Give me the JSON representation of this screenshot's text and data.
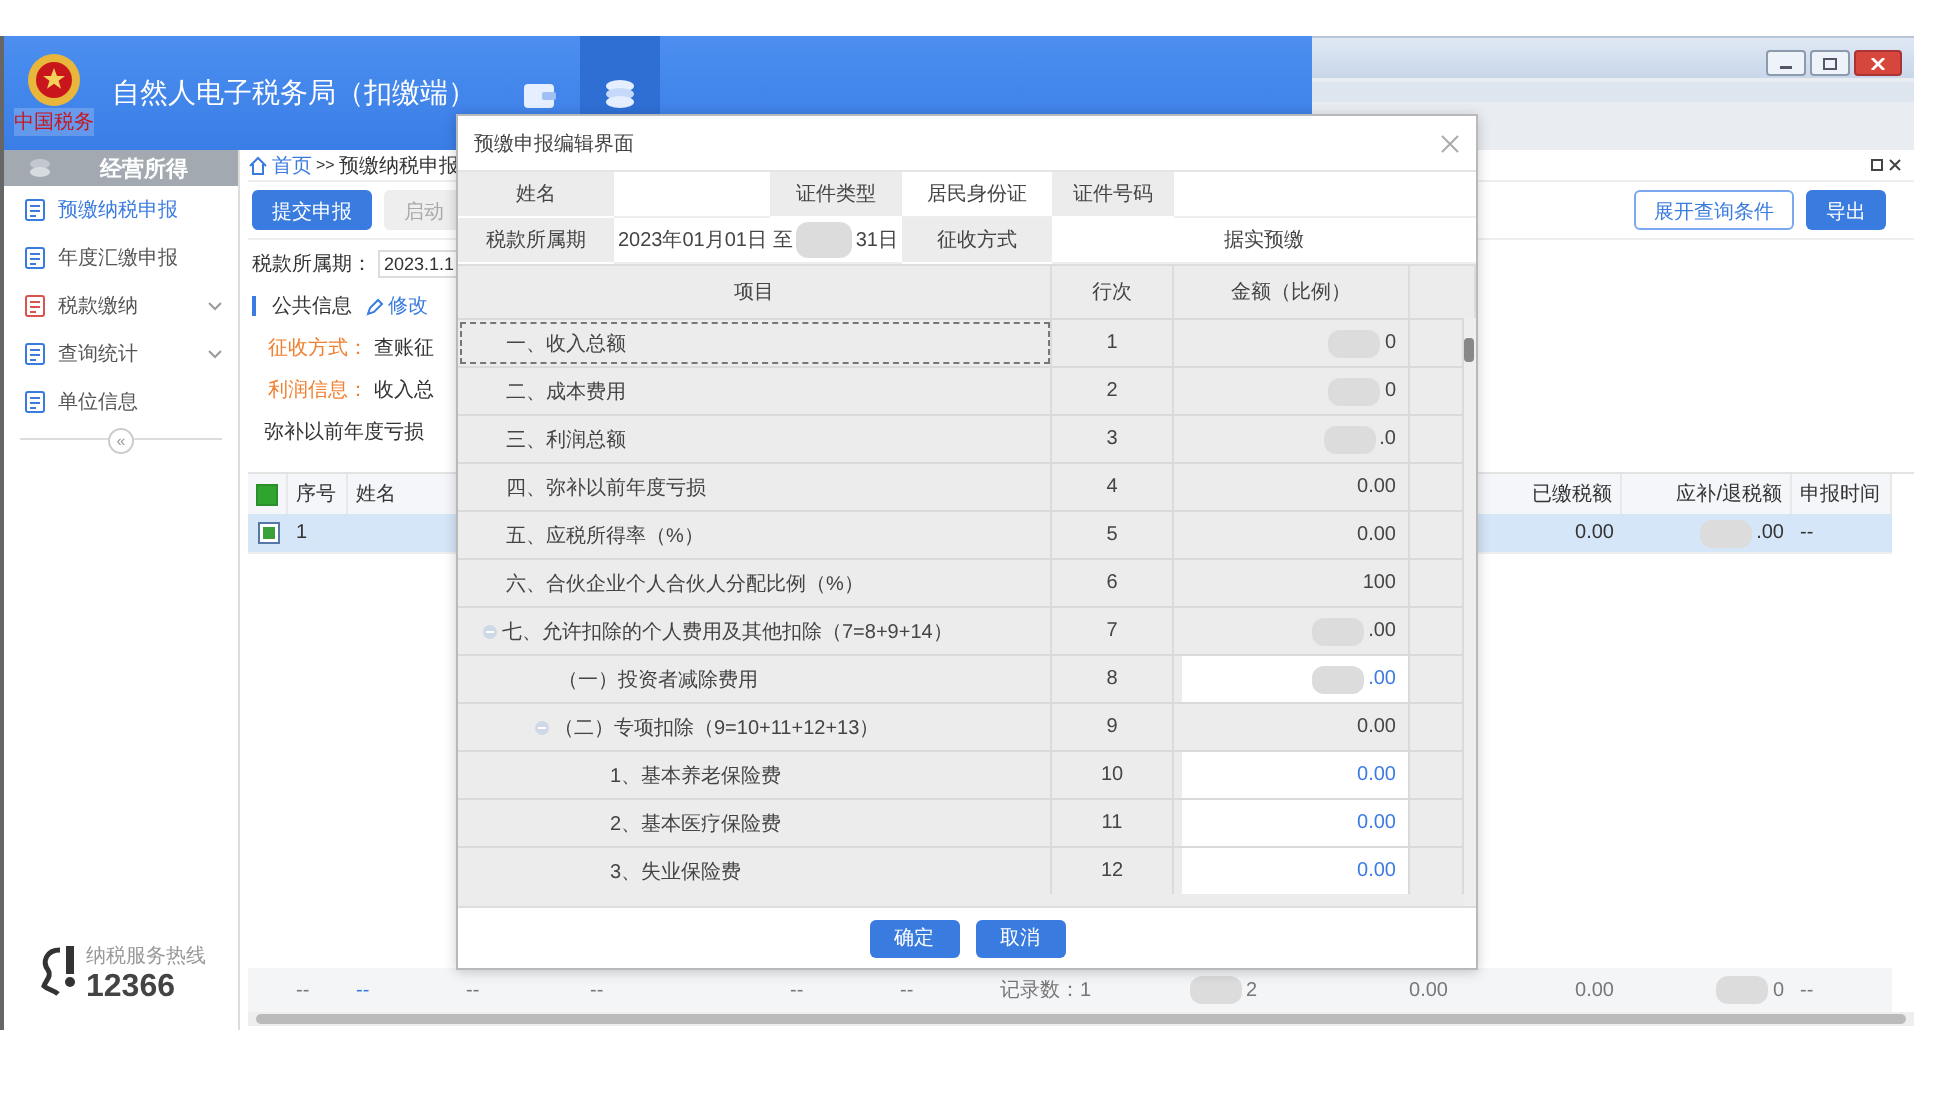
{
  "header": {
    "emblem_text": "中国税务",
    "title": "自然人电子税务局（扣缴端）",
    "nav": [
      {
        "selected": false
      },
      {
        "selected": true
      }
    ]
  },
  "sidebar": {
    "heading": "经营所得",
    "items": [
      {
        "label": "预缴纳税申报",
        "selected": true,
        "expandable": false
      },
      {
        "label": "年度汇缴申报",
        "selected": false,
        "expandable": false
      },
      {
        "label": "税款缴纳",
        "selected": false,
        "expandable": true
      },
      {
        "label": "查询统计",
        "selected": false,
        "expandable": true
      },
      {
        "label": "单位信息",
        "selected": false,
        "expandable": false
      }
    ],
    "collapse": "«",
    "hotline_label": "纳税服务热线",
    "hotline": "12366"
  },
  "breadcrumb": {
    "home": "首页",
    "separator": ">>",
    "current": "预缴纳税申报"
  },
  "toolbar": {
    "buttons": [
      {
        "label": "提交申报",
        "kind": "primary"
      },
      {
        "label": "启动",
        "kind": "default"
      }
    ],
    "right_buttons": [
      {
        "label": "展开查询条件",
        "kind": "outline"
      },
      {
        "label": "导出",
        "kind": "primary"
      }
    ]
  },
  "period": {
    "label": "税款所属期：",
    "value": "2023.1.1"
  },
  "public_info": {
    "title": "公共信息",
    "edit": "修改",
    "lines": [
      {
        "label": "征收方式：",
        "value": "查账征"
      },
      {
        "label": "利润信息：",
        "value": "收入总"
      }
    ],
    "loss_label": "弥补以前年度亏损"
  },
  "table": {
    "all_checked": true,
    "columns": [
      "序号",
      "姓名",
      "已缴税额",
      "应补/退税额",
      "申报时间"
    ],
    "rows": [
      {
        "checked": true,
        "selected": true,
        "no": "1",
        "paid": "0.00",
        "due": ".00",
        "due_redacted": true,
        "time": "--"
      }
    ],
    "footer": [
      {
        "text": "--",
        "kind": "plain",
        "redacted": false
      },
      {
        "text": "--",
        "kind": "link",
        "redacted": false
      },
      {
        "text": "--",
        "kind": "plain",
        "redacted": false
      },
      {
        "text": "--",
        "kind": "plain",
        "redacted": false
      },
      {
        "text": "--",
        "kind": "plain",
        "redacted": false
      },
      {
        "text": "--",
        "kind": "plain",
        "redacted": false
      },
      {
        "text": "记录数：1",
        "kind": "plain",
        "redacted": false
      },
      {
        "text": "2",
        "kind": "plain",
        "redacted": true
      },
      {
        "text": "0.00",
        "kind": "plain",
        "redacted": false
      },
      {
        "text": "0.00",
        "kind": "plain",
        "redacted": false
      },
      {
        "text": "0",
        "kind": "plain",
        "redacted": true
      },
      {
        "text": "--",
        "kind": "plain",
        "redacted": false
      }
    ]
  },
  "modal": {
    "title": "预缴申报编辑界面",
    "info": {
      "name_label": "姓名",
      "id_type_label": "证件类型",
      "id_type": "居民身份证",
      "id_no_label": "证件号码",
      "period_label": "税款所属期",
      "period_start": "2023年01月01日 至",
      "period_end": "31日",
      "collection_label": "征收方式",
      "collection": "据实预缴"
    },
    "columns": [
      "项目",
      "行次",
      "金额（比例）"
    ],
    "rows": [
      {
        "item": "一、收入总额",
        "line": "1",
        "amount": "0",
        "editable": false,
        "redacted": true,
        "selected": true
      },
      {
        "item": "二、成本费用",
        "line": "2",
        "amount": "0",
        "editable": false,
        "redacted": true,
        "selected": false
      },
      {
        "item": "三、利润总额",
        "line": "3",
        "amount": ".0",
        "editable": false,
        "redacted": true,
        "selected": false
      },
      {
        "item": "四、弥补以前年度亏损",
        "line": "4",
        "amount": "0.00",
        "editable": false,
        "redacted": false,
        "selected": false
      },
      {
        "item": "五、应税所得率（%）",
        "line": "5",
        "amount": "0.00",
        "editable": false,
        "redacted": false,
        "selected": false
      },
      {
        "item": "六、合伙企业个人合伙人分配比例（%）",
        "line": "6",
        "amount": "100",
        "editable": false,
        "redacted": false,
        "selected": false
      },
      {
        "item": "七、允许扣除的个人费用及其他扣除（7=8+9+14）",
        "line": "7",
        "amount": ".00",
        "editable": false,
        "redacted": true,
        "selected": false,
        "expanded": true,
        "children": [
          {
            "item": "（一）投资者减除费用",
            "line": "8",
            "amount": ".00",
            "editable": true,
            "redacted": true,
            "selected": false
          },
          {
            "item": "（二）专项扣除（9=10+11+12+13）",
            "line": "9",
            "amount": "0.00",
            "editable": false,
            "redacted": false,
            "selected": false,
            "expanded": true,
            "children": [
              {
                "item": "1、基本养老保险费",
                "line": "10",
                "amount": "0.00",
                "editable": true,
                "redacted": false,
                "selected": false
              },
              {
                "item": "2、基本医疗保险费",
                "line": "11",
                "amount": "0.00",
                "editable": true,
                "redacted": false,
                "selected": false
              },
              {
                "item": "3、失业保险费",
                "line": "12",
                "amount": "0.00",
                "editable": true,
                "redacted": false,
                "selected": false
              }
            ]
          }
        ]
      }
    ],
    "buttons": [
      "确定",
      "取消"
    ]
  }
}
